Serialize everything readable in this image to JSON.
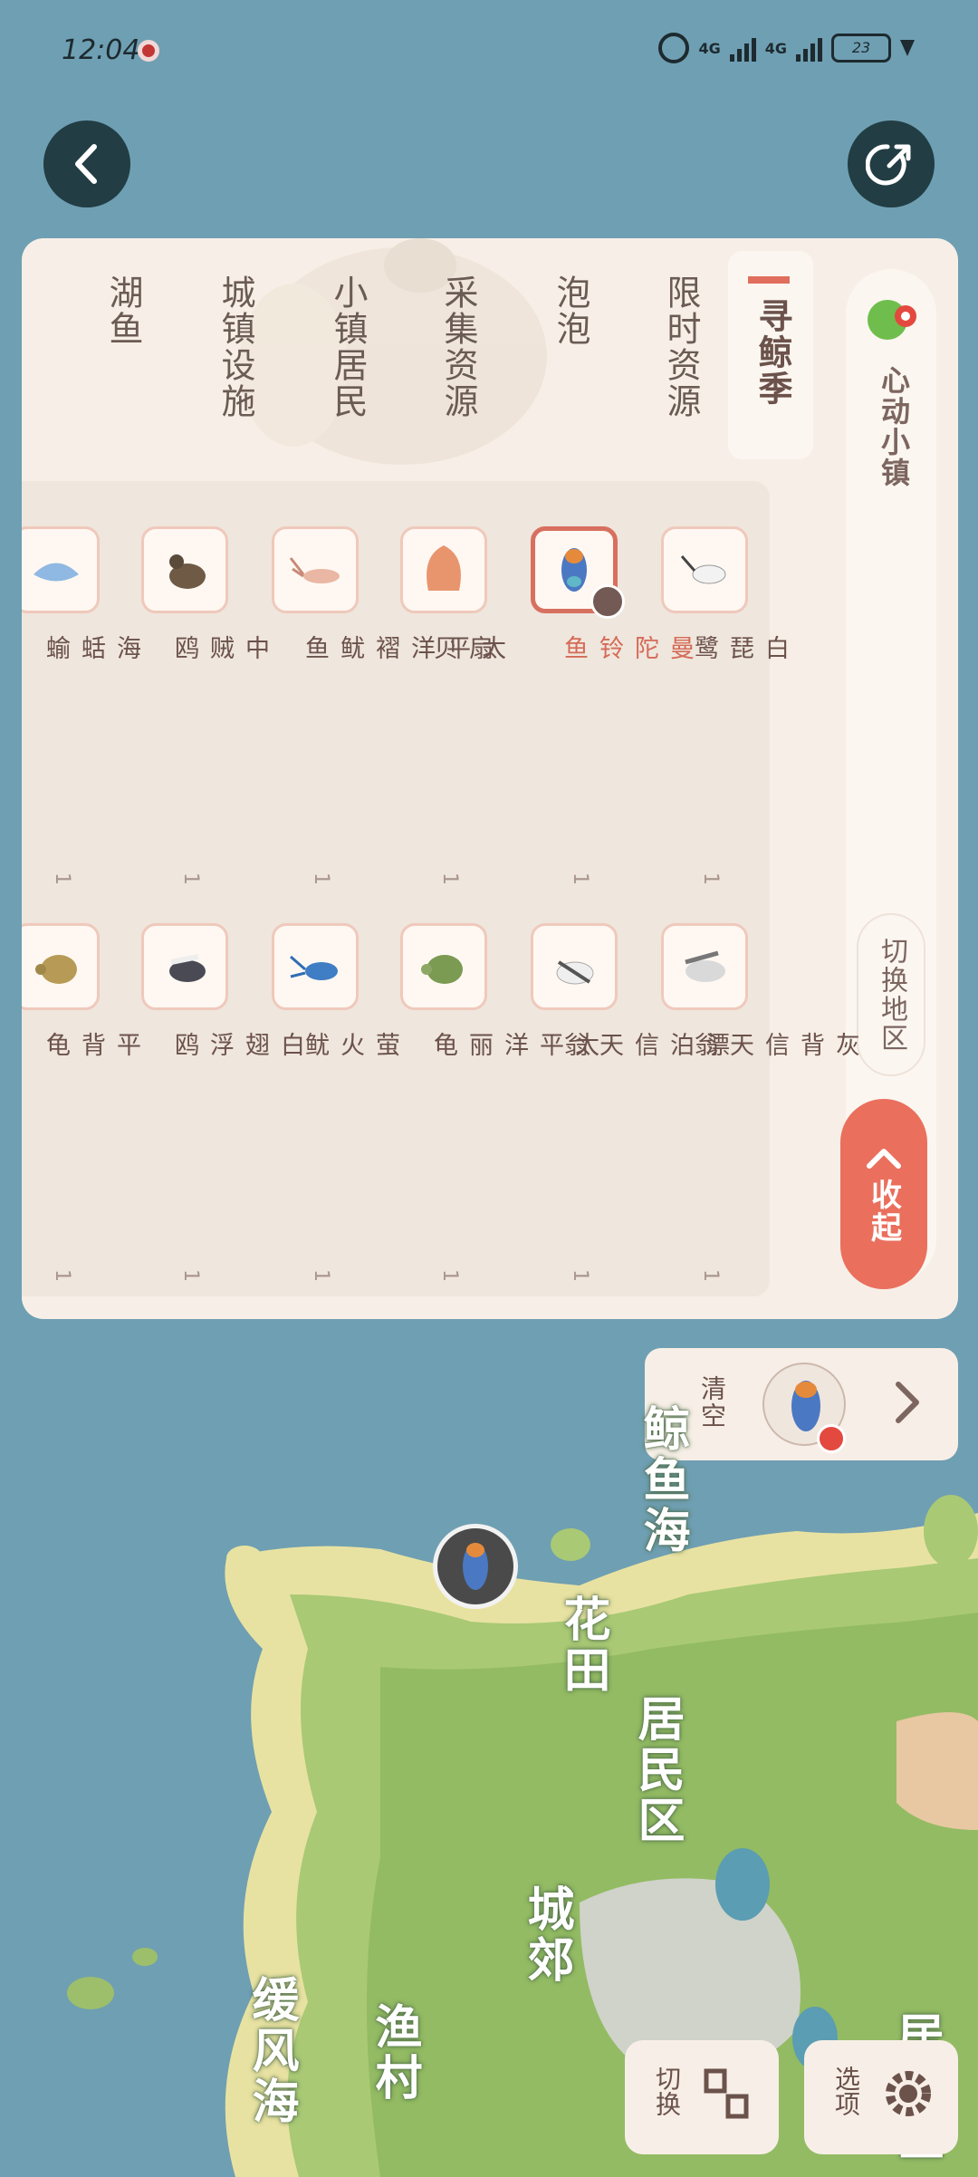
{
  "status_bar": {
    "time": "12:04",
    "net1": "4G",
    "net2": "4G",
    "battery": "23"
  },
  "region": {
    "name": "心动小镇",
    "switch_label": "切换地区",
    "collapse_label": "收起"
  },
  "categories": [
    "寻鲸季",
    "限时资源",
    "泡泡",
    "采集资源",
    "小镇居民",
    "城镇设施",
    "湖鱼"
  ],
  "items_col1": [
    {
      "name": "白琵鹭",
      "count": "1"
    },
    {
      "name": "曼陀铃鱼",
      "count": "1"
    },
    {
      "name": "扇贝",
      "count": "1"
    },
    {
      "name": "太平洋褶鱿鱼",
      "count": "1"
    },
    {
      "name": "中贼鸥",
      "count": "1"
    },
    {
      "name": "海蛞蝓",
      "count": "1"
    }
  ],
  "items_col2": [
    {
      "name": "灰背信天翁",
      "count": "1"
    },
    {
      "name": "漂泊信天翁",
      "count": "1"
    },
    {
      "name": "太平洋丽龟",
      "count": "1"
    },
    {
      "name": "萤火鱿",
      "count": "1"
    },
    {
      "name": "白翅浮鸥",
      "count": "1"
    },
    {
      "name": "平背龟",
      "count": "1"
    }
  ],
  "selected_bar": {
    "clear_label": "清空",
    "badge": "!"
  },
  "map_labels": [
    "鲸鱼海",
    "花田",
    "居民区",
    "城郊",
    "渔村",
    "缓风海",
    "居民区"
  ],
  "bottom": {
    "switch_label": "切换",
    "options_label": "选项"
  }
}
